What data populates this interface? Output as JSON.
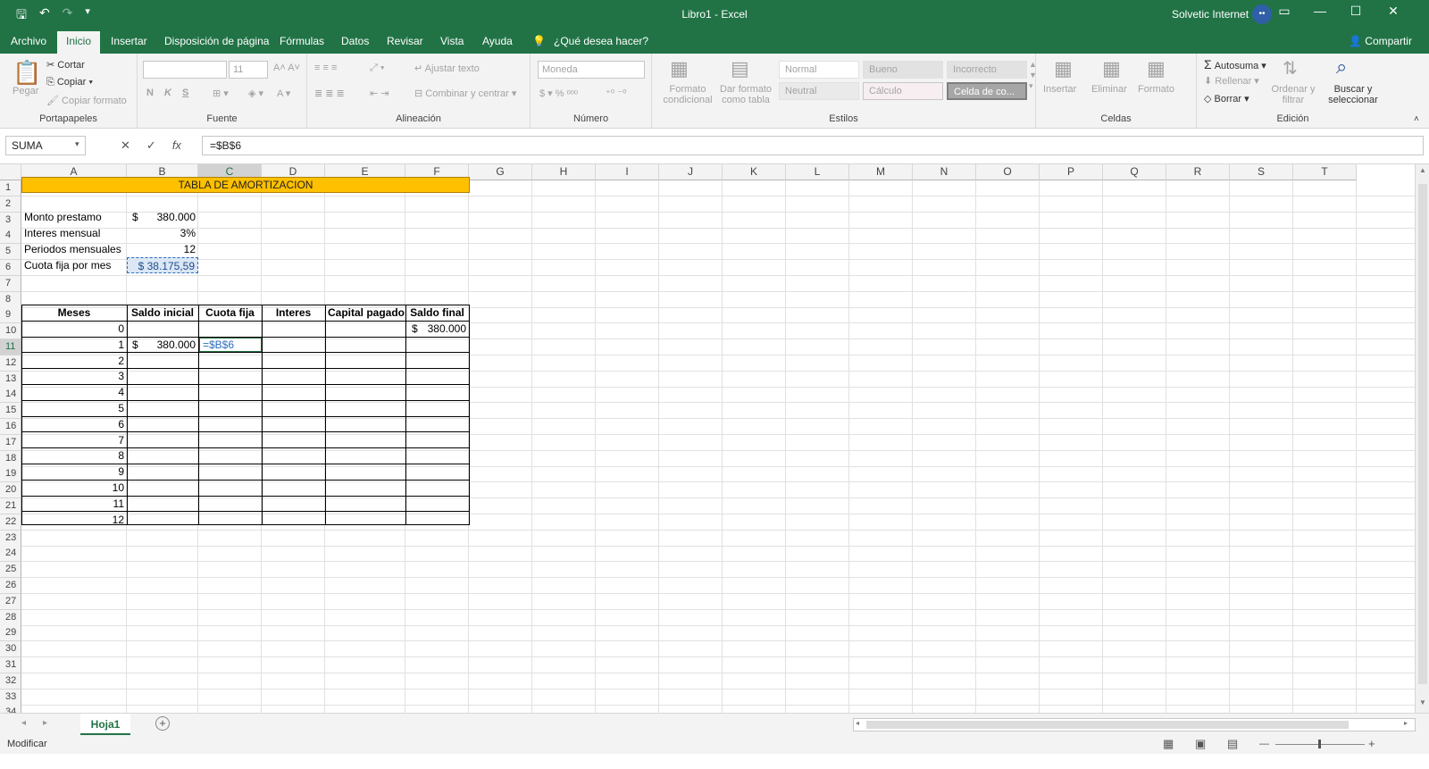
{
  "window": {
    "title": "Libro1  -  Excel",
    "user": "Solvetic Internet",
    "user_initials": "••"
  },
  "tabs": [
    "Archivo",
    "Inicio",
    "Insertar",
    "Disposición de página",
    "Fórmulas",
    "Datos",
    "Revisar",
    "Vista",
    "Ayuda"
  ],
  "active_tab": "Inicio",
  "tell_me": "¿Qué desea hacer?",
  "share": "Compartir",
  "ribbon": {
    "clipboard": {
      "paste": "Pegar",
      "cut": "Cortar",
      "copy": "Copiar",
      "format_painter": "Copiar formato",
      "label": "Portapapeles"
    },
    "font": {
      "size": "11",
      "bold": "N",
      "italic": "K",
      "underline": "S",
      "label": "Fuente"
    },
    "alignment": {
      "wrap": "Ajustar texto",
      "merge": "Combinar y centrar",
      "label": "Alineación"
    },
    "number": {
      "format": "Moneda",
      "label": "Número"
    },
    "styles": {
      "cond_format": "Formato condicional",
      "as_table": "Dar formato como tabla",
      "normal": "Normal",
      "bueno": "Bueno",
      "incorrecto": "Incorrecto",
      "neutral": "Neutral",
      "calculo": "Cálculo",
      "celda": "Celda de co...",
      "label": "Estilos"
    },
    "cells": {
      "insert": "Insertar",
      "delete": "Eliminar",
      "format": "Formato",
      "label": "Celdas"
    },
    "editing": {
      "autosum": "Autosuma",
      "fill": "Rellenar",
      "clear": "Borrar",
      "sort": "Ordenar y filtrar",
      "find": "Buscar y seleccionar",
      "label": "Edición"
    }
  },
  "formula_bar": {
    "name_box": "SUMA",
    "formula": "=$B$6"
  },
  "columns": [
    "A",
    "B",
    "C",
    "D",
    "E",
    "F",
    "G",
    "H",
    "I",
    "J",
    "K",
    "L",
    "M",
    "N",
    "O",
    "P",
    "Q",
    "R",
    "S",
    "T"
  ],
  "rows": [
    "1",
    "2",
    "3",
    "4",
    "5",
    "6",
    "7",
    "8",
    "9",
    "10",
    "11",
    "12",
    "13",
    "14",
    "15",
    "16",
    "17",
    "18",
    "19",
    "20",
    "21",
    "22",
    "23",
    "24",
    "25",
    "26",
    "27",
    "28",
    "29",
    "30",
    "31",
    "32",
    "33",
    "34"
  ],
  "sheet": {
    "title": "TABLA DE AMORTIZACION",
    "labels": {
      "monto": "Monto prestamo",
      "interes": "Interes mensual",
      "periodos": "Periodos mensuales",
      "cuota": "Cuota fija por mes"
    },
    "values": {
      "monto_sym": "$",
      "monto": "380.000",
      "interes": "3%",
      "periodos": "12",
      "cuota": "$ 38.175,59"
    },
    "headers": [
      "Meses",
      "Saldo inicial",
      "Cuota fija",
      "Interes",
      "Capital pagado",
      "Saldo final"
    ],
    "months": [
      "0",
      "1",
      "2",
      "3",
      "4",
      "5",
      "6",
      "7",
      "8",
      "9",
      "10",
      "11",
      "12"
    ],
    "row10_saldo_final_sym": "$",
    "row10_saldo_final": "380.000",
    "row11_saldo_inicial_sym": "$",
    "row11_saldo_inicial": "380.000",
    "editing_cell": "=$B$6"
  },
  "sheet_tab": "Hoja1",
  "status": "Modificar"
}
